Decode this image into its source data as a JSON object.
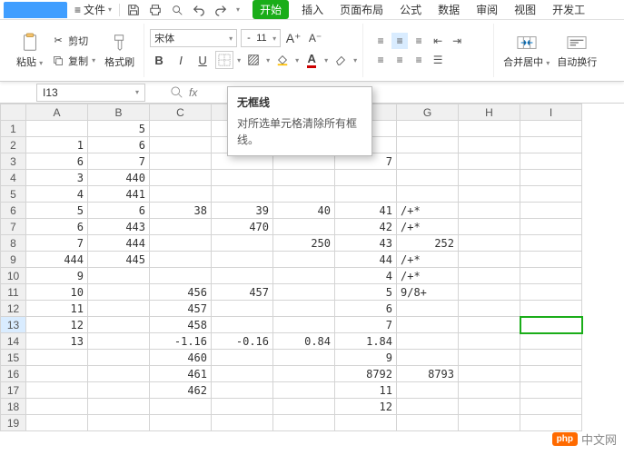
{
  "menu": {
    "file": "文件"
  },
  "tabs": {
    "active": "开始",
    "items": [
      "插入",
      "页面布局",
      "公式",
      "数据",
      "审阅",
      "视图",
      "开发工"
    ]
  },
  "ribbon": {
    "paste": "粘贴",
    "cut": "剪切",
    "copy": "复制",
    "format_painter": "格式刷",
    "font_name": "宋体",
    "font_size": "11",
    "merge_center": "合并居中",
    "wrap_text": "自动换行"
  },
  "namebox": "I13",
  "tooltip": {
    "title": "无框线",
    "body": "对所选单元格清除所有框线。"
  },
  "columns": [
    "A",
    "B",
    "C",
    "D",
    "E",
    "F",
    "G",
    "H",
    "I"
  ],
  "rows": [
    {
      "n": 1,
      "A": "",
      "B": "5"
    },
    {
      "n": 2,
      "A": "1",
      "B": "6"
    },
    {
      "n": 3,
      "A": "6",
      "B": "7",
      "F": "7"
    },
    {
      "n": 4,
      "A": "3",
      "B": "440"
    },
    {
      "n": 5,
      "A": "4",
      "B": "441"
    },
    {
      "n": 6,
      "A": "5",
      "B": "6",
      "C": "38",
      "D": "39",
      "E": "40",
      "F": "41",
      "G": "/+*"
    },
    {
      "n": 7,
      "A": "6",
      "B": "443",
      "D": "470",
      "F": "42",
      "G": "/+*"
    },
    {
      "n": 8,
      "A": "7",
      "B": "444",
      "E": "250",
      "F": "43",
      "G": "252"
    },
    {
      "n": 9,
      "A": "444",
      "B": "445",
      "F": "44",
      "G": "/+*"
    },
    {
      "n": 10,
      "A": "9",
      "F": "4",
      "G": "/+*"
    },
    {
      "n": 11,
      "A": "10",
      "C": "456",
      "D": "457",
      "F": "5",
      "G": "9/8+"
    },
    {
      "n": 12,
      "A": "11",
      "C": "457",
      "F": "6"
    },
    {
      "n": 13,
      "A": "12",
      "C": "458",
      "F": "7"
    },
    {
      "n": 14,
      "A": "13",
      "C": "-1.16",
      "D": "-0.16",
      "E": "0.84",
      "F": "1.84"
    },
    {
      "n": 15,
      "C": "460",
      "F": "9"
    },
    {
      "n": 16,
      "C": "461",
      "F": "8792",
      "G": "8793"
    },
    {
      "n": 17,
      "C": "462",
      "F": "11"
    },
    {
      "n": 18,
      "F": "12"
    },
    {
      "n": 19
    }
  ],
  "watermark": {
    "badge": "php",
    "text": "中文网"
  }
}
